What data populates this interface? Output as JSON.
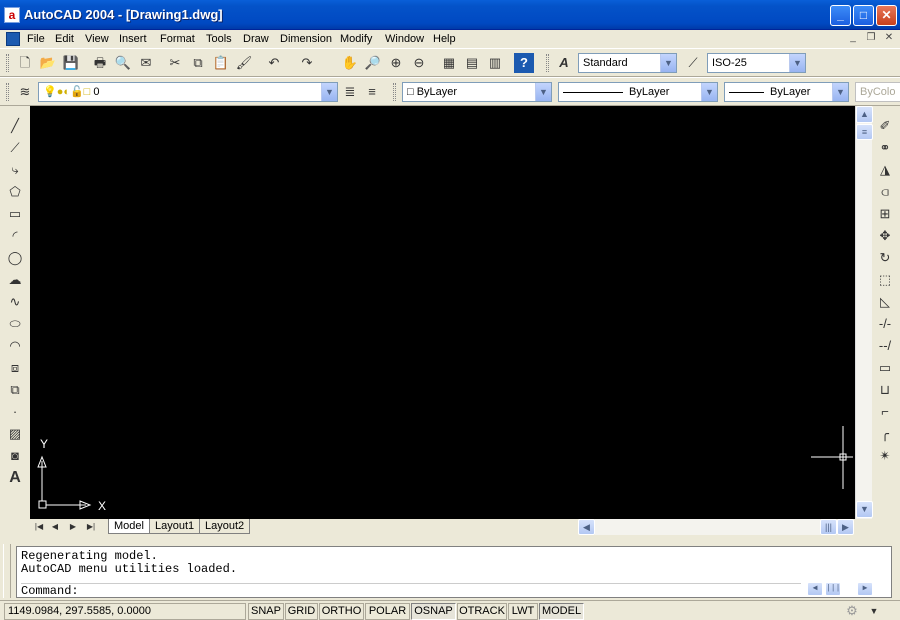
{
  "app": {
    "title": "AutoCAD 2004 - [Drawing1.dwg]",
    "icon": "autocad-app-icon"
  },
  "window_controls": {
    "minimize": "_",
    "maximize": "□",
    "close": "✕"
  },
  "menu": {
    "items": [
      "File",
      "Edit",
      "View",
      "Insert",
      "Format",
      "Tools",
      "Draw",
      "Dimension",
      "Modify",
      "Window",
      "Help"
    ]
  },
  "mdi_controls": {
    "minimize": "_",
    "restore": "❐",
    "close": "✕"
  },
  "standard_toolbar": {
    "text_style": "Standard",
    "dim_style": "ISO-25"
  },
  "layers_toolbar": {
    "layer": "0",
    "color": "ByLayer",
    "linetype": "ByLayer",
    "lineweight": "ByLayer",
    "plotstyle": "ByColo"
  },
  "draw_tools": [
    "line-icon",
    "construction-line-icon",
    "polyline-icon",
    "polygon-icon",
    "rectangle-icon",
    "arc-icon",
    "circle-icon",
    "revision-cloud-icon",
    "spline-icon",
    "ellipse-icon",
    "ellipse-arc-icon",
    "insert-block-icon",
    "make-block-icon",
    "point-icon",
    "hatch-icon",
    "region-icon",
    "multiline-text-icon"
  ],
  "modify_tools": [
    "erase-icon",
    "copy-icon",
    "mirror-icon",
    "offset-icon",
    "array-icon",
    "move-icon",
    "rotate-icon",
    "scale-icon",
    "stretch-icon",
    "trim-icon",
    "extend-icon",
    "break-at-point-icon",
    "break-icon",
    "chamfer-icon",
    "fillet-icon",
    "explode-icon"
  ],
  "ucs": {
    "x_label": "X",
    "y_label": "Y"
  },
  "tabs": [
    "Model",
    "Layout1",
    "Layout2"
  ],
  "active_tab": "Model",
  "command_history": [
    "Regenerating model.",
    "AutoCAD menu utilities loaded."
  ],
  "command_prompt": "Command:",
  "status": {
    "coordinates": "1149.0984, 297.5585, 0.0000",
    "toggles": [
      "SNAP",
      "GRID",
      "ORTHO",
      "POLAR",
      "OSNAP",
      "OTRACK",
      "LWT",
      "MODEL"
    ],
    "pressed": [
      "OSNAP",
      "MODEL"
    ]
  },
  "colors": {
    "canvas": "#000000",
    "titlebar": "#0453c9",
    "face": "#ece9d8"
  }
}
